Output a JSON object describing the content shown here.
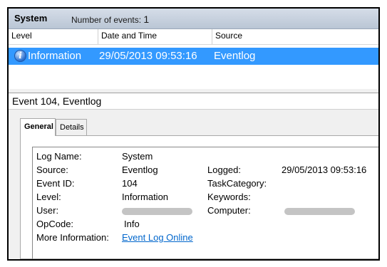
{
  "titlebar": {
    "title": "System",
    "count_label": "Number of events:",
    "count_value": "1"
  },
  "list": {
    "columns": [
      "Level",
      "Date and Time",
      "Source"
    ],
    "rows": [
      {
        "level": "Information",
        "datetime": "29/05/2013 09:53:16",
        "source": "Eventlog",
        "selected": true
      }
    ],
    "scroll_left": "<",
    "scroll_right": ">"
  },
  "detail": {
    "title": "Event 104, Eventlog",
    "tabs": [
      "General",
      "Details"
    ],
    "active_tab": "General",
    "fields": {
      "log_name_label": "Log Name:",
      "log_name": "System",
      "source_label": "Source:",
      "source": "Eventlog",
      "logged_label": "Logged:",
      "logged": "29/05/2013 09:53:16",
      "event_id_label": "Event ID:",
      "event_id": "104",
      "task_category_label": "TaskCategory:",
      "level_label": "Level:",
      "level": "Information",
      "keywords_label": "Keywords:",
      "user_label": "User:",
      "computer_label": "Computer:",
      "opcode_label": "OpCode:",
      "opcode": "Info",
      "more_info_label": "More Information:",
      "more_info_link": "Event Log Online"
    }
  },
  "icons": {
    "info": "information-icon"
  },
  "colors": {
    "selection": "#3399ff",
    "link": "#0066cc"
  }
}
